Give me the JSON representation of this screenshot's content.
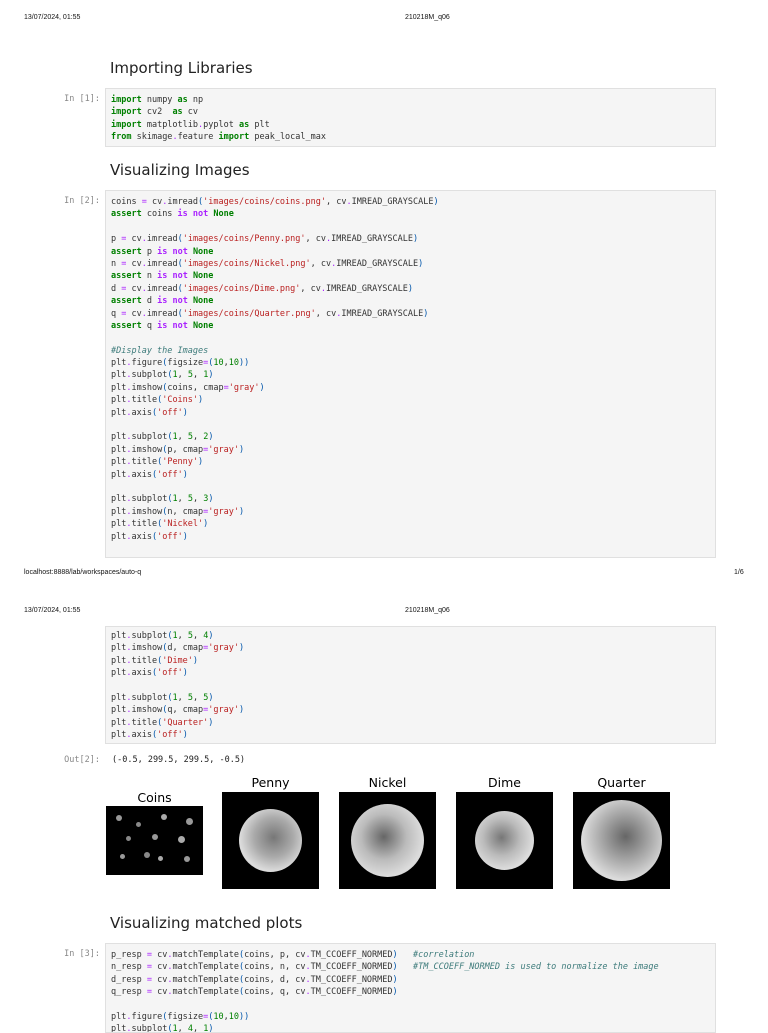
{
  "pages": [
    {
      "header_date": "13/07/2024, 01:55",
      "header_title": "210218M_q06",
      "footer_url": "localhost:8888/lab/workspaces/auto-q",
      "footer_page": "1/6"
    },
    {
      "header_date": "13/07/2024, 01:55",
      "header_title": "210218M_q06"
    }
  ],
  "headings": [
    "Importing Libraries",
    "Visualizing Images",
    "Visualizing matched plots"
  ],
  "cells": [
    {
      "prompt": "In [1]:",
      "lines": [
        "import numpy as np",
        "import cv2  as cv",
        "import matplotlib.pyplot as plt",
        "from skimage.feature import peak_local_max"
      ]
    },
    {
      "prompt": "In [2]:",
      "lines": [
        "coins = cv.imread('images/coins/coins.png', cv.IMREAD_GRAYSCALE)",
        "assert coins is not None",
        "",
        "p = cv.imread('images/coins/Penny.png', cv.IMREAD_GRAYSCALE)",
        "assert p is not None",
        "n = cv.imread('images/coins/Nickel.png', cv.IMREAD_GRAYSCALE)",
        "assert n is not None",
        "d = cv.imread('images/coins/Dime.png', cv.IMREAD_GRAYSCALE)",
        "assert d is not None",
        "q = cv.imread('images/coins/Quarter.png', cv.IMREAD_GRAYSCALE)",
        "assert q is not None",
        "",
        "#Display the Images",
        "plt.figure(figsize=(10,10))",
        "plt.subplot(1, 5, 1)",
        "plt.imshow(coins, cmap='gray')",
        "plt.title('Coins')",
        "plt.axis('off')",
        "",
        "plt.subplot(1, 5, 2)",
        "plt.imshow(p, cmap='gray')",
        "plt.title('Penny')",
        "plt.axis('off')",
        "",
        "plt.subplot(1, 5, 3)",
        "plt.imshow(n, cmap='gray')",
        "plt.title('Nickel')",
        "plt.axis('off')"
      ]
    },
    {
      "prompt": "",
      "lines": [
        "plt.subplot(1, 5, 4)",
        "plt.imshow(d, cmap='gray')",
        "plt.title('Dime')",
        "plt.axis('off')",
        "",
        "plt.subplot(1, 5, 5)",
        "plt.imshow(q, cmap='gray')",
        "plt.title('Quarter')",
        "plt.axis('off')"
      ]
    },
    {
      "prompt": "In [3]:",
      "lines": [
        "p_resp = cv.matchTemplate(coins, p, cv.TM_CCOEFF_NORMED)   #correlation",
        "n_resp = cv.matchTemplate(coins, n, cv.TM_CCOEFF_NORMED)   #TM_CCOEFF_NORMED is used to normalize the image",
        "d_resp = cv.matchTemplate(coins, d, cv.TM_CCOEFF_NORMED)",
        "q_resp = cv.matchTemplate(coins, q, cv.TM_CCOEFF_NORMED)",
        "",
        "plt.figure(figsize=(10,10))",
        "plt.subplot(1, 4, 1)"
      ]
    }
  ],
  "output": {
    "prompt": "Out[2]:",
    "text": "(-0.5, 299.5, 299.5, -0.5)"
  },
  "figures": [
    "Coins",
    "Penny",
    "Nickel",
    "Dime",
    "Quarter"
  ]
}
